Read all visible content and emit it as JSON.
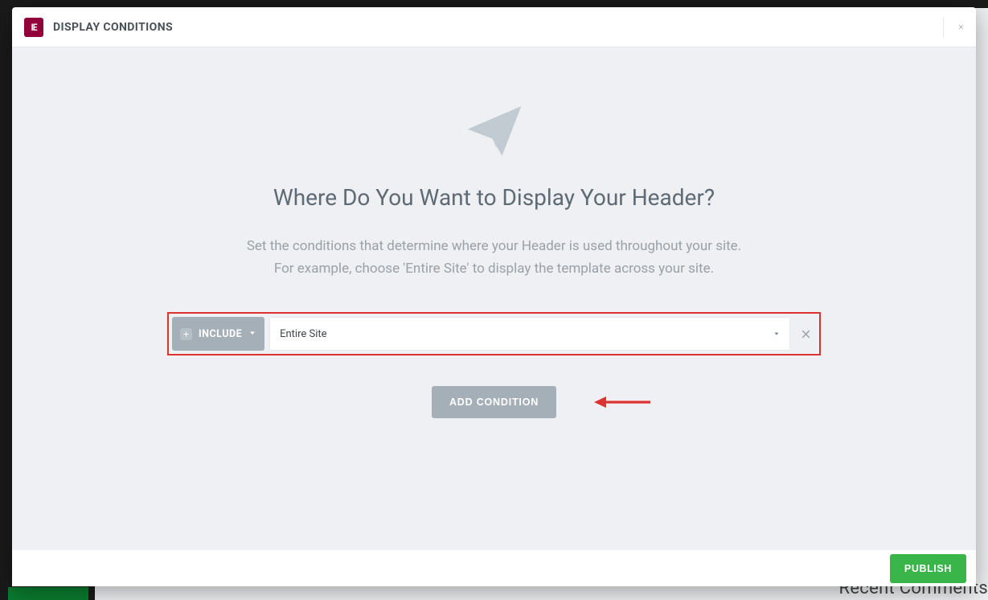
{
  "header": {
    "title": "DISPLAY CONDITIONS"
  },
  "main": {
    "headline": "Where Do You Want to Display Your Header?",
    "subtext_line1": "Set the conditions that determine where your Header is used throughout your site.",
    "subtext_line2": "For example, choose 'Entire Site' to display the template across your site.",
    "condition": {
      "mode_label": "INCLUDE",
      "scope_value": "Entire Site"
    },
    "add_button": "ADD CONDITION"
  },
  "footer": {
    "publish_label": "PUBLISH"
  },
  "background": {
    "recent_comments_text": "Recent Comments"
  },
  "colors": {
    "accent_red": "#dc3232",
    "publish_green": "#39b54a",
    "brand_magenta": "#92003b"
  }
}
